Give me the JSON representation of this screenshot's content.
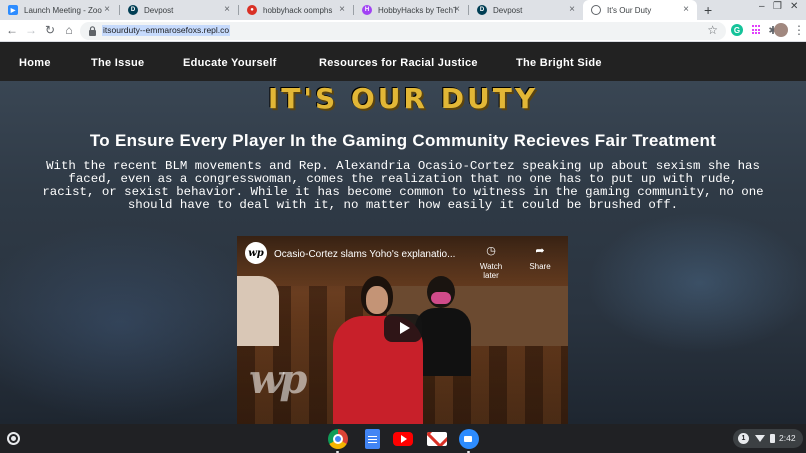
{
  "tabs": [
    {
      "title": "Launch Meeting - Zoom",
      "icon": "zoom-icon",
      "color": "#2d8cff"
    },
    {
      "title": "Devpost",
      "icon": "devpost-icon",
      "color": "#003e54"
    },
    {
      "title": "hobbyhack oomphs",
      "icon": "record-icon",
      "color": "#d93025"
    },
    {
      "title": "HobbyHacks by TechTo...",
      "icon": "hobbyhacks-icon",
      "color": "#a142f4"
    },
    {
      "title": "Devpost",
      "icon": "devpost-icon",
      "color": "#003e54"
    },
    {
      "title": "It's Our Duty",
      "icon": "globe-icon",
      "color": "#5f6368",
      "active": true
    }
  ],
  "new_tab": "+",
  "window_controls": {
    "minimize": "–",
    "restore": "❐",
    "close": "✕"
  },
  "toolbar": {
    "back": "←",
    "forward": "→",
    "reload": "↻",
    "home": "⌂",
    "url": "itsourduty--emmarosefoxs.repl.co",
    "bookmark": "☆",
    "grammarly": "G",
    "extensions": "✱",
    "menu": "⋮"
  },
  "nav": {
    "home": "Home",
    "issue": "The Issue",
    "educate": "Educate Yourself",
    "resources": "Resources for Racial Justice",
    "bright_side": "The Bright Side"
  },
  "hero": {
    "title": "IT'S OUR DUTY",
    "subtitle": "To Ensure Every Player In the Gaming Community Recieves Fair Treatment",
    "paragraph": "With the recent BLM movements and Rep. Alexandria Ocasio-Cortez speaking up about sexism she has faced, even as a congresswoman, comes the realization that no one has to put up with rude, racist, or sexist behavior. While it has become common to witness in the gaming community, no one should have to deal with it, no matter how easily it could be brushed off."
  },
  "video": {
    "channel_logo": "wp",
    "title": "Ocasio-Cortez slams Yoho's explanatio...",
    "watch_later": "Watch later",
    "share": "Share",
    "watermark": "wp"
  },
  "shelf": {
    "notification_count": "1",
    "time": "2:42"
  },
  "colors": {
    "title_gold": "#e2b736",
    "navbar": "#222222",
    "accent_blue": "#1a73e8"
  }
}
